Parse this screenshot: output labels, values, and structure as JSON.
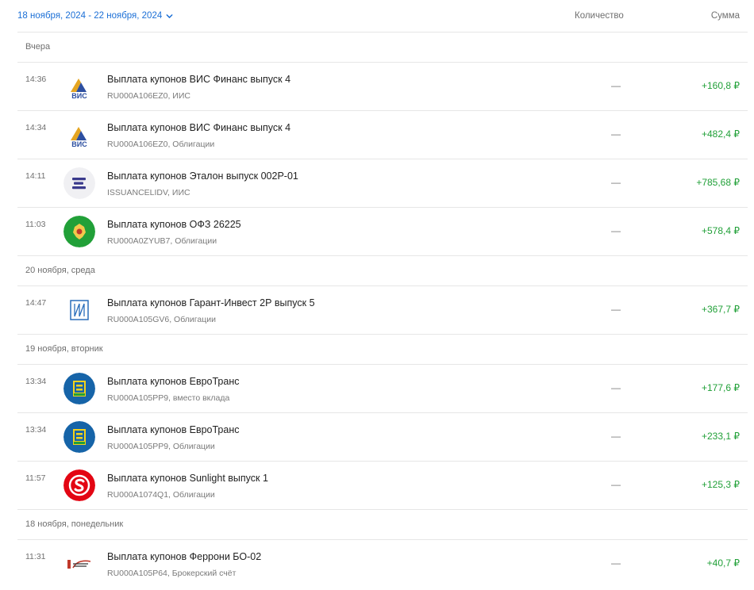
{
  "header": {
    "date_range": "18 ноября, 2024 - 22 ноября, 2024",
    "col_quantity": "Количество",
    "col_sum": "Сумма"
  },
  "colors": {
    "accent": "#1b6fd6",
    "positive": "#21a038",
    "muted": "#6f6f6f"
  },
  "groups": [
    {
      "label": "Вчера",
      "rows": [
        {
          "time": "14:36",
          "title": "Выплата купонов ВИС Финанс выпуск 4",
          "sub": "RU000A106EZ0, ИИС",
          "qty": "—",
          "amount": "+160,8 ₽",
          "logo": "vis-logo"
        },
        {
          "time": "14:34",
          "title": "Выплата купонов ВИС Финанс выпуск 4",
          "sub": "RU000A106EZ0, Облигации",
          "qty": "—",
          "amount": "+482,4 ₽",
          "logo": "vis-logo"
        },
        {
          "time": "14:11",
          "title": "Выплата купонов Эталон выпуск 002Р-01",
          "sub": "ISSUANCELIDV, ИИС",
          "qty": "—",
          "amount": "+785,68 ₽",
          "logo": "etalon-logo"
        },
        {
          "time": "11:03",
          "title": "Выплата купонов ОФЗ 26225",
          "sub": "RU000A0ZYUB7, Облигации",
          "qty": "—",
          "amount": "+578,4 ₽",
          "logo": "ofz-emblem-logo"
        }
      ]
    },
    {
      "label": "20 ноября, среда",
      "rows": [
        {
          "time": "14:47",
          "title": "Выплата купонов Гарант-Инвест 2Р выпуск 5",
          "sub": "RU000A105GV6, Облигации",
          "qty": "—",
          "amount": "+367,7 ₽",
          "logo": "garant-invest-logo"
        }
      ]
    },
    {
      "label": "19 ноября, вторник",
      "rows": [
        {
          "time": "13:34",
          "title": "Выплата купонов ЕвроТранс",
          "sub": "RU000A105PP9, вместо вклада",
          "qty": "—",
          "amount": "+177,6 ₽",
          "logo": "eurotrans-logo"
        },
        {
          "time": "13:34",
          "title": "Выплата купонов ЕвроТранс",
          "sub": "RU000A105PP9, Облигации",
          "qty": "—",
          "amount": "+233,1 ₽",
          "logo": "eurotrans-logo"
        },
        {
          "time": "11:57",
          "title": "Выплата купонов Sunlight выпуск 1",
          "sub": "RU000A1074Q1, Облигации",
          "qty": "—",
          "amount": "+125,3 ₽",
          "logo": "sunlight-logo"
        }
      ]
    },
    {
      "label": "18 ноября, понедельник",
      "rows": [
        {
          "time": "11:31",
          "title": "Выплата купонов Феррони БО-02",
          "sub": "RU000A105P64, Брокерский счёт",
          "qty": "—",
          "amount": "+40,7 ₽",
          "logo": "ferroni-logo"
        }
      ]
    }
  ]
}
